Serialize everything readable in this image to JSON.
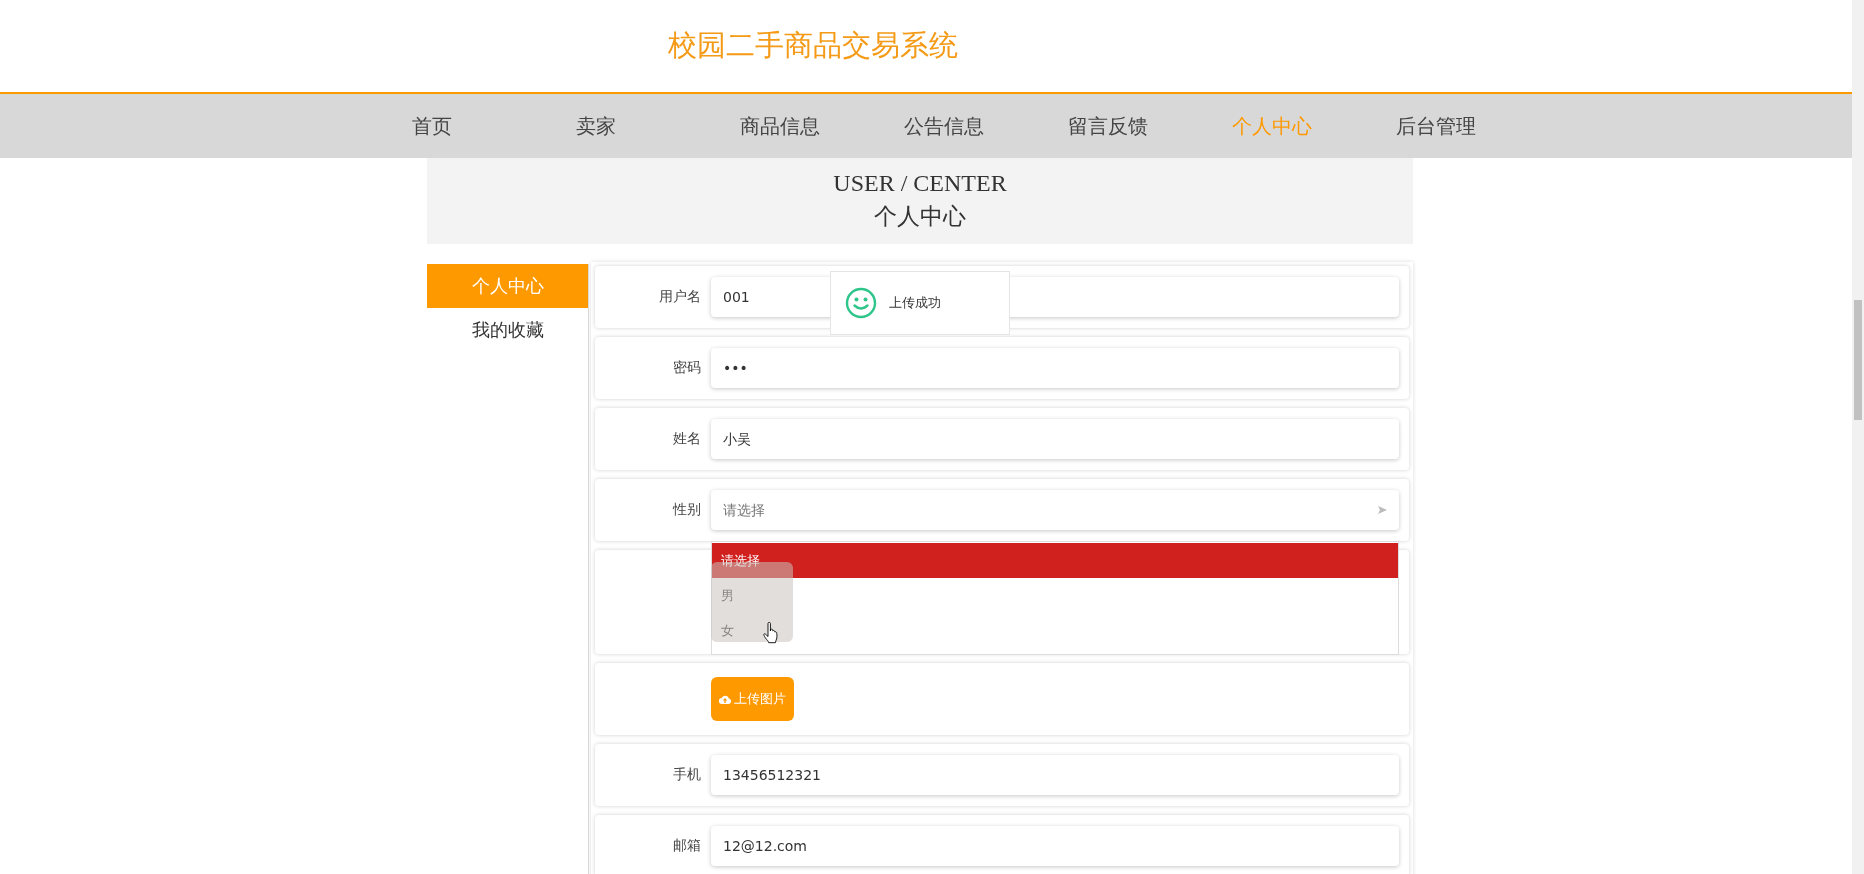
{
  "site_title": "校园二手商品交易系统",
  "nav": [
    {
      "label": "首页",
      "selected": false
    },
    {
      "label": "卖家",
      "selected": false
    },
    {
      "label": "商品信息",
      "selected": false
    },
    {
      "label": "公告信息",
      "selected": false
    },
    {
      "label": "留言反馈",
      "selected": false
    },
    {
      "label": "个人中心",
      "selected": true
    },
    {
      "label": "后台管理",
      "selected": false
    }
  ],
  "banner": {
    "title_en": "USER / CENTER",
    "title_cn": "个人中心"
  },
  "sidebar": [
    {
      "label": "个人中心",
      "selected": true
    },
    {
      "label": "我的收藏",
      "selected": false
    }
  ],
  "form": {
    "fields": [
      {
        "kind": "input",
        "label": "用户名",
        "value": "001"
      },
      {
        "kind": "input",
        "label": "密码",
        "value": "•••"
      },
      {
        "kind": "input",
        "label": "姓名",
        "value": "小吴"
      },
      {
        "kind": "select",
        "label": "性别",
        "placeholder": "请选择",
        "expanded": true,
        "options": [
          {
            "label": "请选择",
            "selected": true
          },
          {
            "label": "男",
            "selected": false
          },
          {
            "label": "女",
            "selected": false
          }
        ]
      },
      {
        "kind": "image"
      },
      {
        "kind": "upload",
        "button": "上传图片"
      },
      {
        "kind": "input",
        "label": "手机",
        "value": "13456512321"
      },
      {
        "kind": "input",
        "label": "邮箱",
        "value": "12@12.com"
      }
    ]
  },
  "toast": {
    "message": "上传成功"
  }
}
